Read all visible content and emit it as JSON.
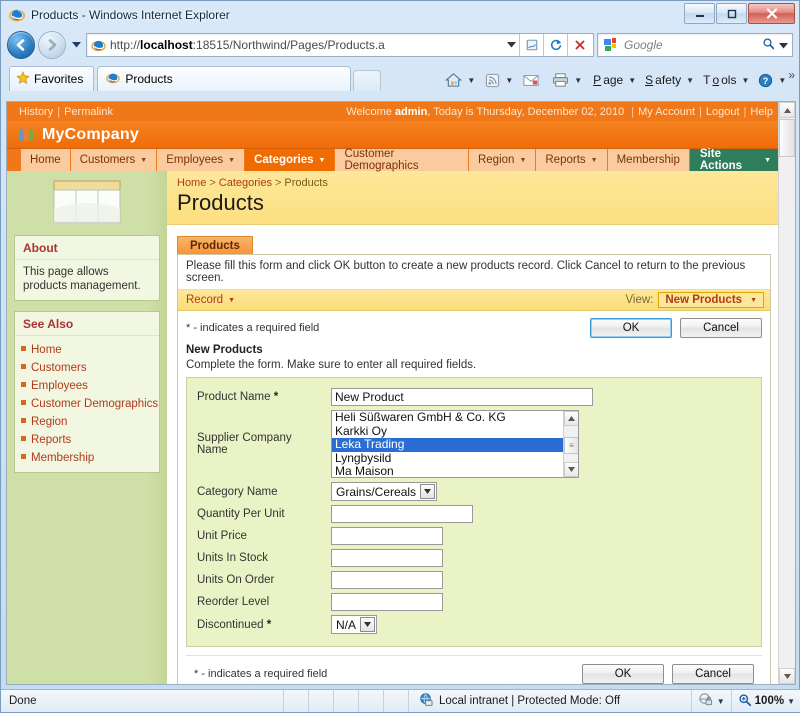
{
  "window": {
    "title": "Products - Windows Internet Explorer",
    "minimize_label": "Minimize",
    "maximize_label": "Maximize",
    "close_label": "Close"
  },
  "browser": {
    "back_label": "Back",
    "forward_label": "Forward",
    "recent_pages_label": "Recent Pages",
    "url": "http://localhost:18515/Northwind/Pages/Products.a",
    "url_host": "localhost",
    "url_scheme": "http://",
    "url_rest": ":18515/Northwind/Pages/Products.a",
    "compat_view_label": "Compatibility View",
    "refresh_label": "Refresh",
    "stop_label": "Stop",
    "search_placeholder": "Google",
    "search_value": "",
    "favorites_label": "Favorites",
    "tab_label": "Products",
    "new_tab_label": "New Tab",
    "command_bar": [
      {
        "label": "Home",
        "icon": "home-icon",
        "has_caret": true
      },
      {
        "label": "Feeds",
        "icon": "feeds-icon",
        "has_caret": true
      },
      {
        "label": "Read Mail",
        "icon": "mail-icon",
        "has_caret": false
      },
      {
        "label": "Print",
        "icon": "print-icon",
        "has_caret": true
      },
      {
        "label": "Page",
        "icon": "",
        "has_caret": true
      },
      {
        "label": "Safety",
        "icon": "",
        "has_caret": true
      },
      {
        "label": "Tools",
        "icon": "",
        "has_caret": true
      },
      {
        "label": "Help",
        "icon": "help-icon",
        "has_caret": true
      }
    ],
    "overflow_label": "»"
  },
  "site_header": {
    "history_label": "History",
    "permalink_label": "Permalink",
    "welcome_prefix": "Welcome ",
    "welcome_user": "admin",
    "welcome_suffix": ", Today is Thursday, December 02, 2010 ",
    "my_account_label": "My Account",
    "logout_label": "Logout",
    "help_label": "Help",
    "brand_name": "MyCompany"
  },
  "main_menu": {
    "items": [
      {
        "label": "Home",
        "has_caret": false,
        "active": false
      },
      {
        "label": "Customers",
        "has_caret": true,
        "active": false
      },
      {
        "label": "Employees",
        "has_caret": true,
        "active": false
      },
      {
        "label": "Categories",
        "has_caret": true,
        "active": true
      },
      {
        "label": "Customer Demographics",
        "has_caret": false,
        "active": false
      },
      {
        "label": "Region",
        "has_caret": true,
        "active": false
      },
      {
        "label": "Reports",
        "has_caret": true,
        "active": false
      },
      {
        "label": "Membership",
        "has_caret": false,
        "active": false
      }
    ],
    "site_actions_label": "Site Actions"
  },
  "sidebar": {
    "about": {
      "heading": "About",
      "text": "This page allows products management."
    },
    "see_also": {
      "heading": "See Also",
      "links": [
        "Home",
        "Customers",
        "Employees",
        "Customer Demographics",
        "Region",
        "Reports",
        "Membership"
      ]
    }
  },
  "page": {
    "breadcrumb": [
      "Home",
      "Categories",
      "Products"
    ],
    "breadcrumb_sep": ">",
    "title": "Products",
    "tab_label": "Products",
    "hint": "Please fill this form and click OK button to create a new products record. Click Cancel to return to the previous screen.",
    "record_menu_label": "Record",
    "view_label": "View:",
    "view_value": "New Products",
    "required_note": "* - indicates a required field",
    "form_title": "New Products",
    "form_description": "Complete the form. Make sure to enter all required fields.",
    "ok_label": "OK",
    "cancel_label": "Cancel"
  },
  "form": {
    "fields": [
      {
        "label": "Product Name",
        "required": true,
        "type": "text",
        "value": "New Product",
        "size": "wide"
      },
      {
        "label": "Supplier Company Name",
        "required": false,
        "type": "listbox",
        "value": "Leka Trading"
      },
      {
        "label": "Category Name",
        "required": false,
        "type": "dropdown",
        "value": "Grains/Cereals"
      },
      {
        "label": "Quantity Per Unit",
        "required": false,
        "type": "text",
        "value": "",
        "size": "med"
      },
      {
        "label": "Unit Price",
        "required": false,
        "type": "text",
        "value": "",
        "size": "sm"
      },
      {
        "label": "Units In Stock",
        "required": false,
        "type": "text",
        "value": "",
        "size": "sm"
      },
      {
        "label": "Units On Order",
        "required": false,
        "type": "text",
        "value": "",
        "size": "sm"
      },
      {
        "label": "Reorder Level",
        "required": false,
        "type": "text",
        "value": "",
        "size": "sm"
      },
      {
        "label": "Discontinued",
        "required": true,
        "type": "dropdown",
        "value": "N/A"
      }
    ],
    "supplier_options": [
      "Heli Süßwaren GmbH & Co. KG",
      "Karkki Oy",
      "Leka Trading",
      "Lyngbysild",
      "Ma Maison"
    ],
    "supplier_selected_index": 2
  },
  "status_bar": {
    "message": "Done",
    "zone": "Local intranet | Protected Mode: Off",
    "zoom": "100%",
    "privacy_icon": "privacy-report-icon",
    "zoom_icon": "zoom-icon"
  },
  "colors": {
    "accent_orange": "#f07818",
    "accent_green": "#2e7d5b",
    "title_band": "#fde79a",
    "field_bg": "#e9f3c6",
    "sidebar_bg": "#cfdfa8",
    "link_red": "#b03a1a",
    "select_blue": "#2a6ed4"
  }
}
